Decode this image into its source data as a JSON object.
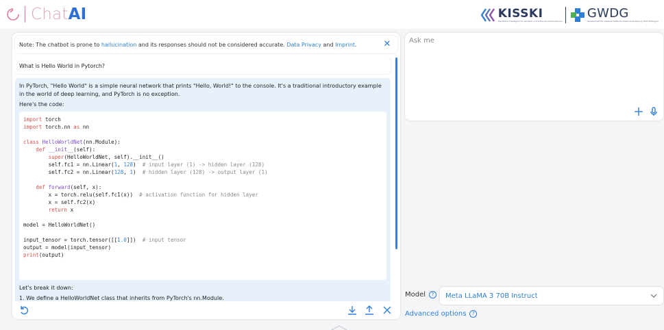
{
  "header": {
    "brand_name": "Chat",
    "brand_ai": "AI",
    "partner_kisski": "KISSKI",
    "partner_kisski_sub": "Künstliche Intelligenz für sensible und kritische Infrastrukturen",
    "partner_gwdg": "GWDG",
    "partner_gwdg_sub": "Gesellschaft für wissenschaftliche Datenverarbeitung mbH Göttingen"
  },
  "notice": {
    "prefix": "Note: The chatbot is prone to ",
    "link_hallucination": "hallucination",
    "middle": " and its responses should not be considered accurate. ",
    "link_privacy": "Data Privacy",
    "and": " and ",
    "link_imprint": "Imprint",
    "suffix": "."
  },
  "conversation": {
    "user_message": "What is Hello World in Pytorch?",
    "bot_intro": "In PyTorch, \"Hello World\" is a simple neural network that prints \"Hello, World!\" to the console. It's a traditional introductory example in the world of deep learning, and PyTorch is no exception.",
    "bot_here": "Here's the code:",
    "bot_breakdown": "Let's break it down:",
    "bot_cut_line": "1. We define a HelloWorldNet class that inherits from PyTorch's nn.Module."
  },
  "input": {
    "placeholder": "Ask me"
  },
  "model": {
    "label": "Model",
    "selected": "Meta LLaMA 3 70B Instruct"
  },
  "advanced": {
    "label": "Advanced options"
  },
  "colors": {
    "accent": "#2f7fd6",
    "bot_bg": "#e8f1fb",
    "brand_pink": "#d9a2b5"
  },
  "icons": {
    "logo": "chat-logo-icon",
    "close": "close-icon",
    "reset": "reset-icon",
    "download": "download-icon",
    "upload": "upload-icon",
    "clear": "clear-icon",
    "add": "plus-icon",
    "mic": "microphone-icon",
    "help": "help-icon",
    "chevron": "chevron-down-icon"
  }
}
